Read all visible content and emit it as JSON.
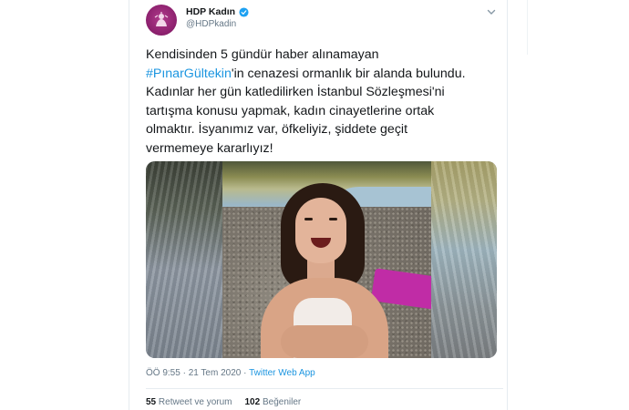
{
  "account": {
    "display_name": "HDP Kadın",
    "handle": "@HDPkadin",
    "verified": true
  },
  "tweet": {
    "lines": [
      {
        "text": "Kendisinden 5 gündür haber alınamayan"
      },
      {
        "hashtag": "#PınarGültekin",
        "text": "'in cenazesi ormanlık bir alanda bulundu."
      },
      {
        "text": "Kadınlar her gün katledilirken İstanbul Sözleşmesi'ni"
      },
      {
        "text": "tartışma konusu yapmak, kadın cinayetlerine ortak"
      },
      {
        "text": "olmaktır. İsyanımız var, öfkeliyiz, şiddete geçit"
      },
      {
        "text": "vermemeye kararlıyız!"
      }
    ]
  },
  "meta": {
    "time": "ÖÖ 9:55",
    "separator": " · ",
    "date": "21 Tem 2020",
    "source": "Twitter Web App"
  },
  "stats": {
    "retweets_count": "55",
    "retweets_label": "Retweet ve yorum",
    "likes_count": "102",
    "likes_label": "Beğeniler"
  },
  "colors": {
    "link": "#1b95e0",
    "text": "#14171a",
    "secondary": "#657786",
    "avatar": "#8a1f6c"
  },
  "icons": {
    "verified": "verified-badge-icon",
    "menu": "chevron-down-icon"
  }
}
